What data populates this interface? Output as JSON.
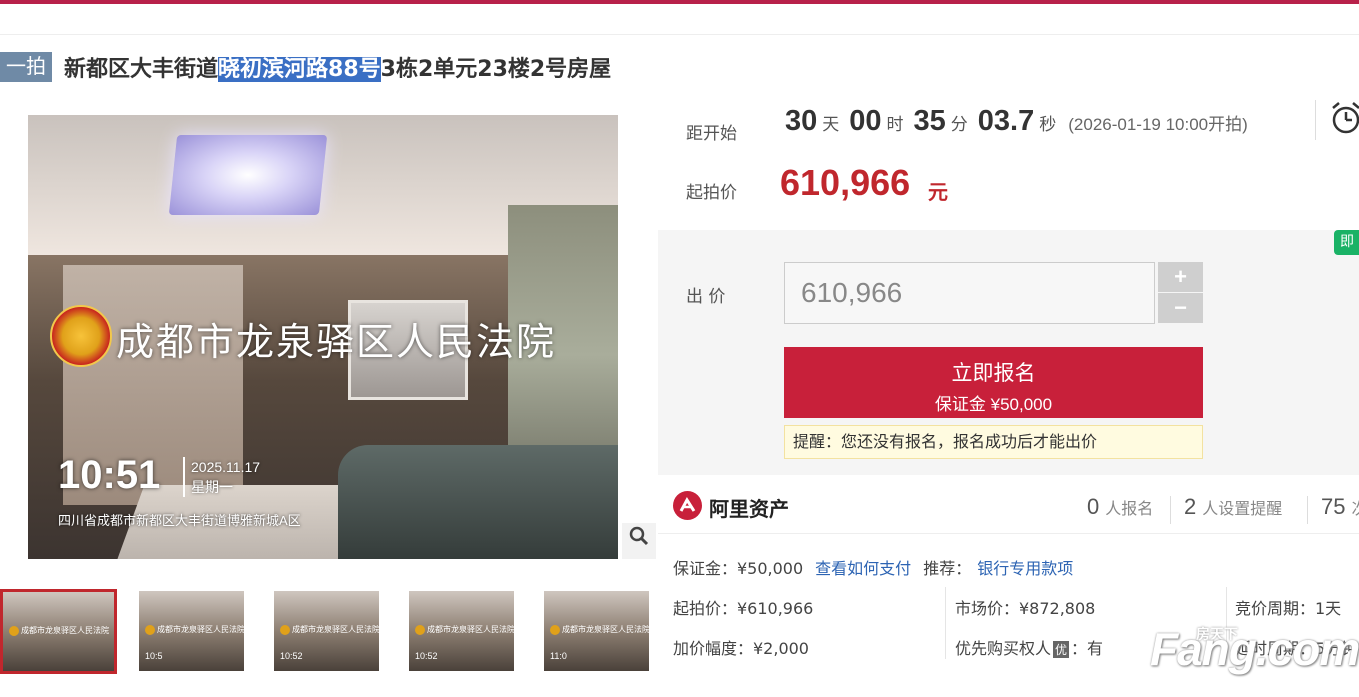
{
  "header": {
    "tag": "一拍",
    "title_pre": "新都区大丰街道",
    "title_highlight": "晓初滨河路88号",
    "title_post": "3栋2单元23楼2号房屋"
  },
  "photo": {
    "court_name": "成都市龙泉驿区人民法院",
    "time": "10:51",
    "date": "2025.11.17",
    "weekday": "星期一",
    "address": "四川省成都市新都区大丰街道博雅新城A区"
  },
  "thumbnails": [
    {
      "court": "成都市龙泉驿区人民法院",
      "time": ""
    },
    {
      "court": "成都市龙泉驿区人民法院",
      "time": "10:5"
    },
    {
      "court": "成都市龙泉驿区人民法院",
      "time": "10:52"
    },
    {
      "court": "成都市龙泉驿区人民法院",
      "time": "10:52"
    },
    {
      "court": "成都市龙泉驿区人民法院",
      "time": "11:0"
    }
  ],
  "auction": {
    "countdown_label": "距开始",
    "days": "30",
    "days_unit": "天",
    "hours": "00",
    "hours_unit": "时",
    "minutes": "35",
    "minutes_unit": "分",
    "seconds": "03.7",
    "seconds_unit": "秒",
    "start_time": "(2026-01-19 10:00开拍)",
    "start_price_label": "起拍价",
    "start_price": "610,966",
    "start_price_unit": "元"
  },
  "bid": {
    "label": "出 价",
    "value": "610,966",
    "plus": "+",
    "minus": "−",
    "badge": "即",
    "signup_label": "立即报名",
    "deposit_label": "保证金 ¥50,000",
    "reminder": "提醒：您还没有报名，报名成功后才能出价"
  },
  "platform": {
    "name": "阿里资产",
    "signups": "0",
    "signups_label": "人报名",
    "reminders": "2",
    "reminders_label": "人设置提醒",
    "views": "75",
    "views_label": "次"
  },
  "details": {
    "deposit": "保证金：¥50,000",
    "how_to_pay": "查看如何支付",
    "recommend_label": "推荐：",
    "recommend_link": "银行专用款项",
    "start_price": "起拍价：¥610,966",
    "market_price": "市场价：¥872,808",
    "cycle": "竞价周期：1天",
    "increment": "加价幅度：¥2,000",
    "priority_label": "优先购买权人",
    "priority_icon": "优",
    "priority_value": "：有",
    "delay": "延时周期：5分钟"
  },
  "watermark": {
    "top": "房天下",
    "main": "Fang.com"
  }
}
